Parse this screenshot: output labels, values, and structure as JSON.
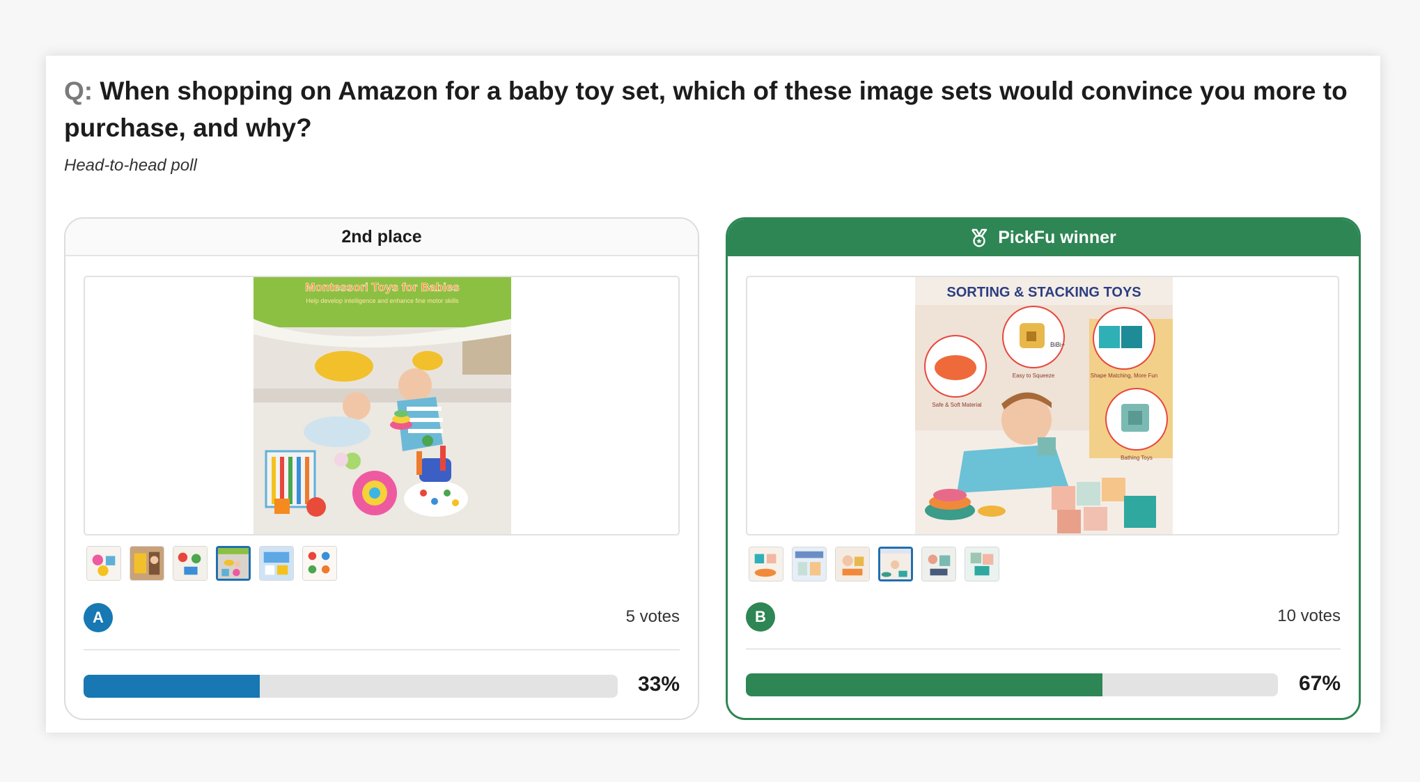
{
  "question": {
    "prefix": "Q:",
    "text": "When shopping on Amazon for a baby toy set, which of these image sets would convince you more to purchase, and why?"
  },
  "poll_type": "Head-to-head poll",
  "options": [
    {
      "header": "2nd place",
      "letter": "A",
      "votes": "5 votes",
      "percent_label": "33%",
      "share": 0.33,
      "color": "#1778b3",
      "image": {
        "banner_title": "Montessori Toys for Babies",
        "banner_subtitle": "Help develop intelligence and enhance fine motor skills"
      },
      "thumbnail_count": 6,
      "selected_thumbnail": 4
    },
    {
      "header": "PickFu winner",
      "header_icon": "medal-icon",
      "letter": "B",
      "votes": "10 votes",
      "percent_label": "67%",
      "share": 0.67,
      "color": "#2e8654",
      "image": {
        "title": "SORTING & STACKING TOYS",
        "callout_1": "Safe & Soft Material",
        "callout_2": "Easy to Squeeze",
        "callout_3": "Shape Matching, More Fun",
        "callout_4": "Bathing Toys",
        "bubble": "BiBi~"
      },
      "thumbnail_count": 6,
      "selected_thumbnail": 4
    }
  ]
}
